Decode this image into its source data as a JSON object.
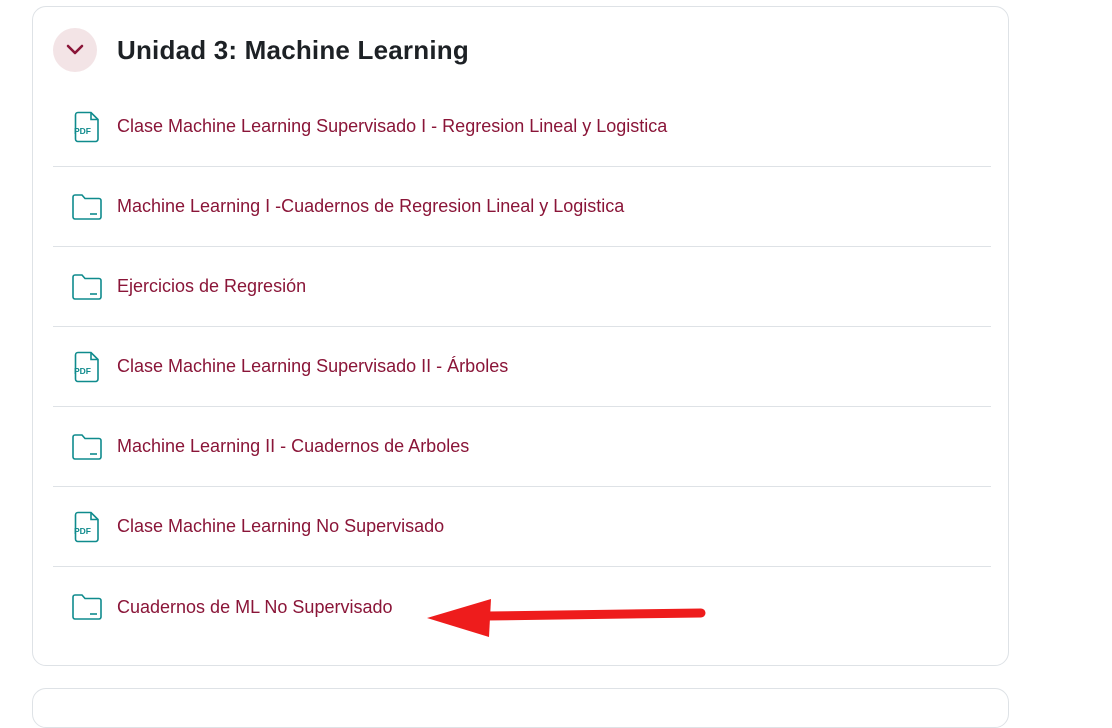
{
  "section": {
    "title": "Unidad 3: Machine Learning",
    "collapse_icon": "chevron-down-icon"
  },
  "activities": [
    {
      "type": "pdf",
      "icon": "pdf-file-icon",
      "label": "Clase Machine Learning Supervisado I - Regresion Lineal y Logistica"
    },
    {
      "type": "folder",
      "icon": "folder-icon",
      "label": "Machine Learning I -Cuadernos de Regresion Lineal y Logistica"
    },
    {
      "type": "folder",
      "icon": "folder-icon",
      "label": "Ejercicios de Regresión"
    },
    {
      "type": "pdf",
      "icon": "pdf-file-icon",
      "label": "Clase Machine Learning Supervisado II - Árboles"
    },
    {
      "type": "folder",
      "icon": "folder-icon",
      "label": "Machine Learning II - Cuadernos de Arboles"
    },
    {
      "type": "pdf",
      "icon": "pdf-file-icon",
      "label": "Clase Machine Learning No Supervisado"
    },
    {
      "type": "folder",
      "icon": "folder-icon",
      "label": "Cuadernos de ML No Supervisado"
    }
  ],
  "colors": {
    "link": "#8a1538",
    "icon": "#0f8b8d",
    "annotation_arrow": "#ee1c1c"
  },
  "annotation": {
    "icon": "red-arrow-annotation",
    "points_to": "Cuadernos de ML No Supervisado"
  }
}
